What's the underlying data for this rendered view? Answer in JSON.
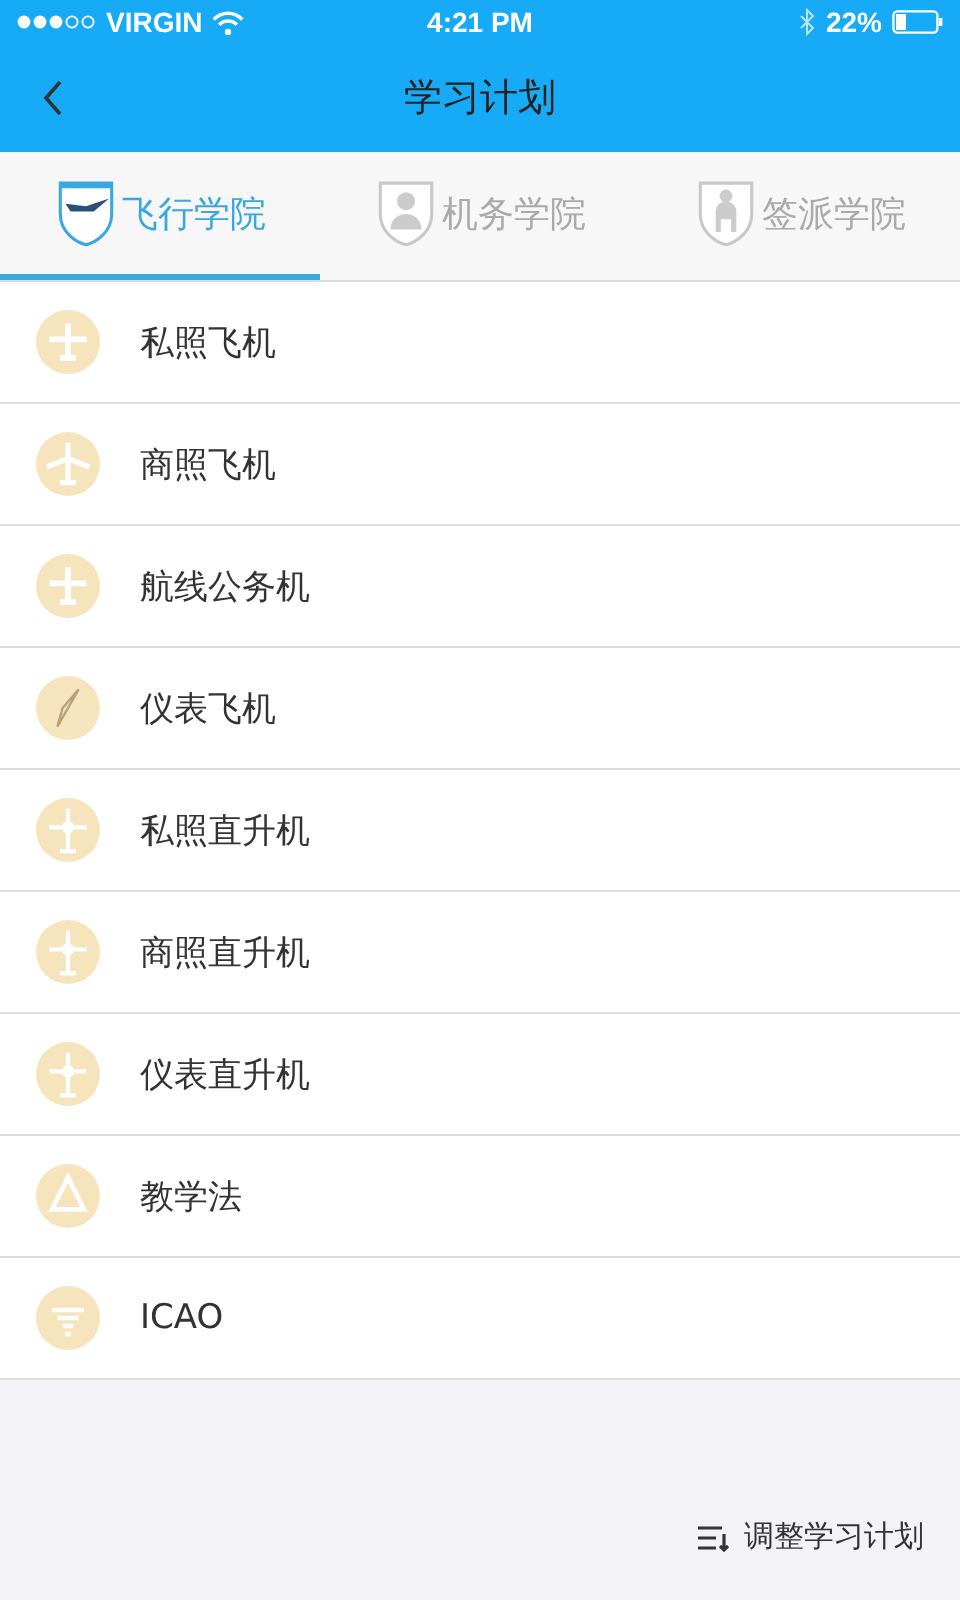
{
  "status_bar": {
    "carrier": "VIRGIN",
    "time": "4:21 PM",
    "battery": "22%"
  },
  "nav_bar": {
    "title": "学习计划"
  },
  "tabs": [
    {
      "label": "飞行学院",
      "selected": true,
      "kind": "plane"
    },
    {
      "label": "机务学院",
      "selected": false,
      "kind": "person"
    },
    {
      "label": "签派学院",
      "selected": false,
      "kind": "seat"
    }
  ],
  "courses": [
    {
      "label": "私照飞机",
      "kind": "plane"
    },
    {
      "label": "商照飞机",
      "kind": "jet"
    },
    {
      "label": "航线公务机",
      "kind": "plane"
    },
    {
      "label": "仪表飞机",
      "kind": "compass"
    },
    {
      "label": "私照直升机",
      "kind": "helicopter"
    },
    {
      "label": "商照直升机",
      "kind": "helicopter"
    },
    {
      "label": "仪表直升机",
      "kind": "helicopter"
    },
    {
      "label": "教学法",
      "kind": "cone"
    },
    {
      "label": "ICAO",
      "kind": "funnel"
    }
  ],
  "adjust_button": {
    "label": "调整学习计划"
  }
}
